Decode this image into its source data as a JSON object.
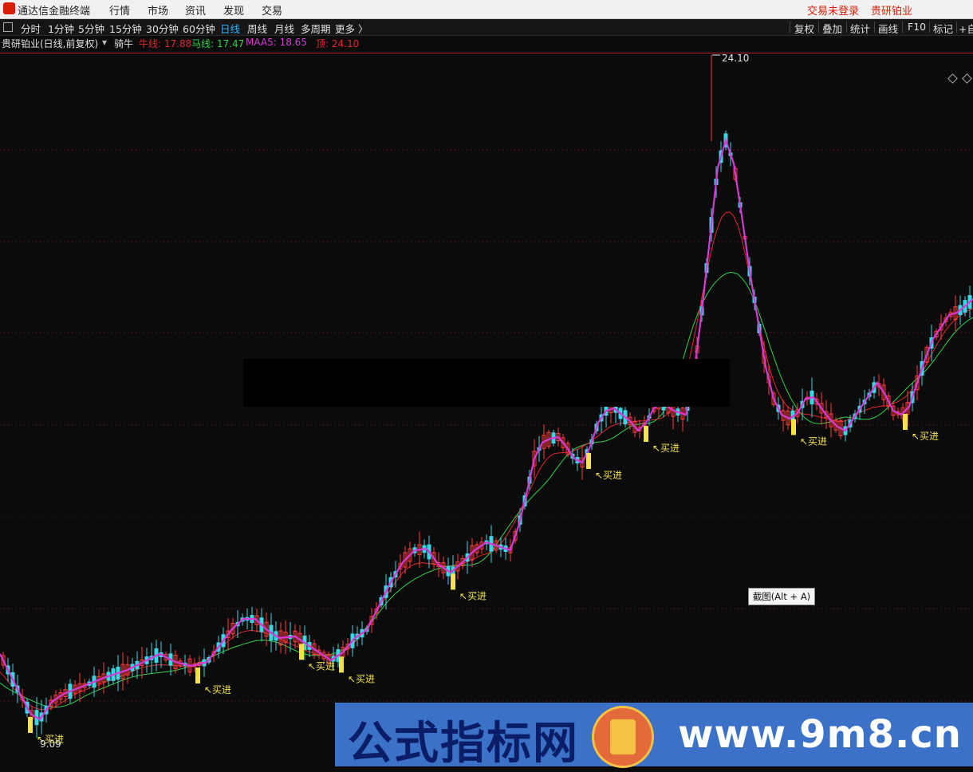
{
  "topbar": {
    "app_title": "通达信金融终端",
    "menus": [
      "行情",
      "市场",
      "资讯",
      "发现",
      "交易"
    ],
    "login_status": "交易未登录",
    "stock_name": "贵研铂业"
  },
  "periods": {
    "items": [
      "分时",
      "1分钟",
      "5分钟",
      "15分钟",
      "30分钟",
      "60分钟",
      "日线",
      "周线",
      "月线",
      "多周期",
      "更多 〉"
    ],
    "active": "日线",
    "tools": [
      "复权",
      "叠加",
      "统计",
      "画线",
      "F10",
      "标记",
      "+自"
    ]
  },
  "infobar": {
    "title": "贵研铂业(日线,前复权)",
    "indicator": "骑牛",
    "bull_label": "牛线: 17.88",
    "horse_label": "马线: 17.47",
    "maa5_label": "MAA5: 18.65",
    "top_label": "顶: 24.10",
    "colors": {
      "bull": "#e0282e",
      "horse": "#2fd34a",
      "maa5": "#d63ad6",
      "top": "#e0282e",
      "title": "#e0e0e0"
    }
  },
  "chart": {
    "high_label": "24.10",
    "low_label": "9.09",
    "buy_label": "买进"
  },
  "tooltip": "截图(Alt + A)",
  "banner": {
    "left_text": "公式指标网",
    "right_text": "www.9m8.cn"
  }
}
